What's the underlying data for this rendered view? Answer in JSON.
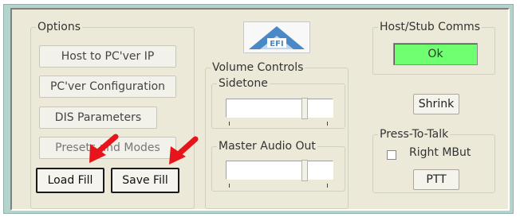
{
  "options": {
    "title": "Options",
    "buttons": {
      "host_to_pcver_ip": "Host to PC'ver IP",
      "pcver_configuration": "PC'ver Configuration",
      "dis_parameters": "DIS Parameters",
      "presets_and_modes": "Presets and Modes",
      "load_fill": "Load Fill",
      "save_fill": "Save Fill"
    }
  },
  "volume_controls": {
    "title": "Volume Controls",
    "sidetone": {
      "label": "Sidetone",
      "level": 0.75
    },
    "master_audio_out": {
      "label": "Master Audio Out",
      "level": 0.75
    }
  },
  "host_stub_comms": {
    "title": "Host/Stub Comms",
    "status": "Ok"
  },
  "shrink_button": "Shrink",
  "press_to_talk": {
    "title": "Press-To-Talk",
    "checkbox_label": "Right MBut",
    "checked": false,
    "ptt_button": "PTT"
  },
  "logo": {
    "text": "EFI"
  },
  "colors": {
    "status_ok": "#70ff70",
    "arrow": "#e8141c",
    "frame": "#b2d4cc"
  },
  "annotations": {
    "arrow_count": 2
  }
}
